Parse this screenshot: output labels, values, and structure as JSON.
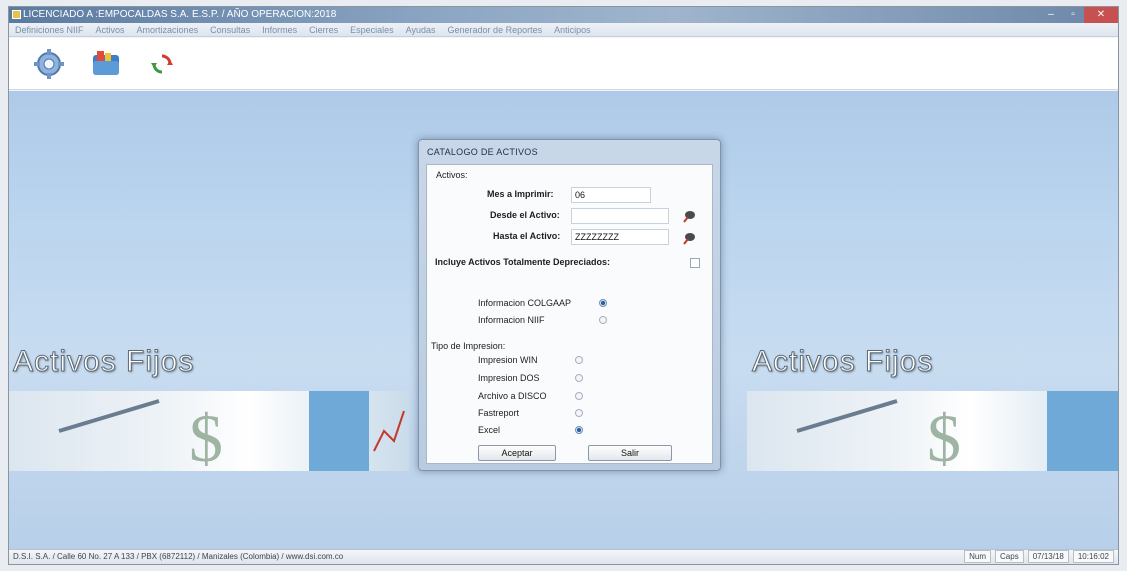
{
  "window": {
    "title": "LICENCIADO A :EMPOCALDAS S.A. E.S.P.  /  AÑO OPERACION:2018"
  },
  "menu": [
    "Definiciones NIIF",
    "Activos",
    "Amortizaciones",
    "Consultas",
    "Informes",
    "Cierres",
    "Especiales",
    "Ayudas",
    "Generador de Reportes",
    "Anticipos"
  ],
  "toolbar": {
    "icons": [
      "gear-icon",
      "folder-icon",
      "refresh-icon"
    ]
  },
  "desktop": {
    "banner_left": "Activos Fijos",
    "banner_right": "Activos Fijos"
  },
  "dialog": {
    "title": "CATALOGO DE ACTIVOS",
    "section_activos": "Activos:",
    "mes_label": "Mes a Imprimir:",
    "mes_value": "06",
    "desde_label": "Desde el Activo:",
    "desde_value": "",
    "hasta_label": "Hasta el Activo:",
    "hasta_value": "ZZZZZZZZ",
    "incluye_label": "Incluye Activos Totalmente Depreciados:",
    "incluye_checked": false,
    "info_colgaap": "Informacion COLGAAP",
    "info_niif": "Informacion NIIF",
    "info_selected": "colgaap",
    "tipo_label": "Tipo de Impresion:",
    "tipos": [
      "Impresion WIN",
      "Impresion DOS",
      "Archivo a DISCO",
      "Fastreport",
      "Excel"
    ],
    "tipo_selected": "Excel",
    "aceptar": "Aceptar",
    "salir": "Salir"
  },
  "statusbar": {
    "text": "D.S.I. S.A. / Calle 60 No. 27 A 133 / PBX (6872112) / Manizales (Colombia) / www.dsi.com.co",
    "num": "Num",
    "caps": "Caps",
    "date": "07/13/18",
    "time": "10:16:02"
  }
}
